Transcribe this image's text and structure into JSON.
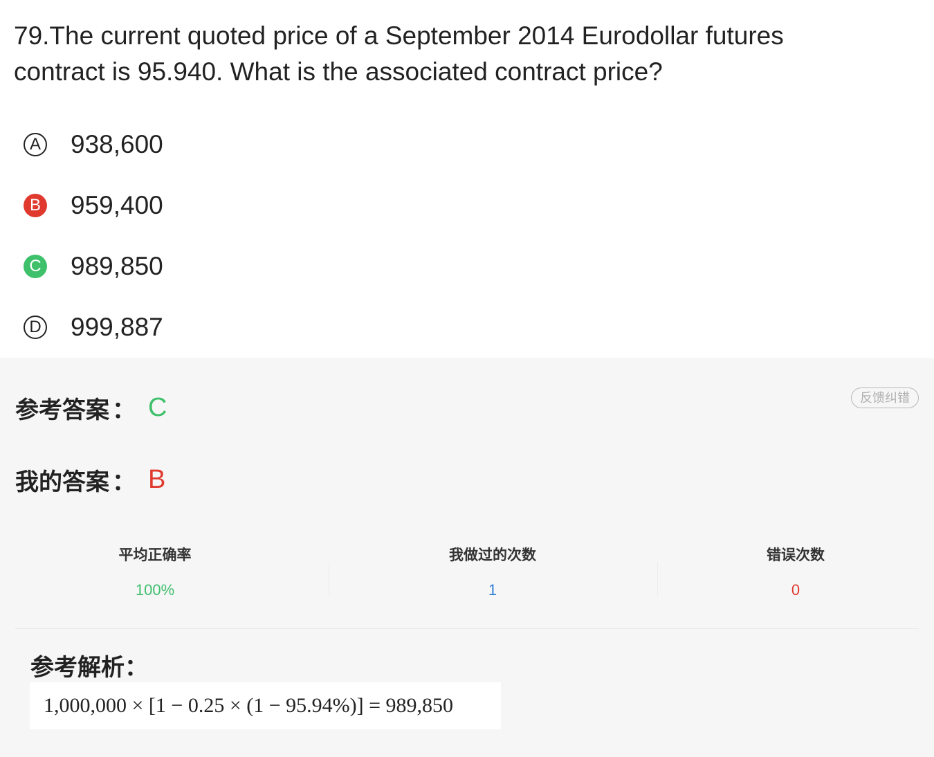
{
  "question": {
    "text": "79.The current quoted price of a September 2014 Eurodollar futures contract is 95.940. What is the associated contract price?"
  },
  "options": [
    {
      "letter": "A",
      "text": "938,600",
      "state": "normal"
    },
    {
      "letter": "B",
      "text": "959,400",
      "state": "wrong"
    },
    {
      "letter": "C",
      "text": "989,850",
      "state": "correct"
    },
    {
      "letter": "D",
      "text": "999,887",
      "state": "normal"
    }
  ],
  "answers": {
    "reference_label": "参考答案",
    "reference_value": "C",
    "mine_label": "我的答案",
    "mine_value": "B",
    "colon": "："
  },
  "feedback_button": "反馈纠错",
  "stats": [
    {
      "label": "平均正确率",
      "value": "100%",
      "color": "#3fbf6e"
    },
    {
      "label": "我做过的次数",
      "value": "1",
      "color": "#2f7fd6"
    },
    {
      "label": "错误次数",
      "value": "0",
      "color": "#e03a2f"
    }
  ],
  "analysis": {
    "title": "参考解析：",
    "formula": "1,000,000 × [1 − 0.25 × (1 − 95.94%)] = 989,850"
  },
  "colors": {
    "correct": "#3fc06a",
    "wrong": "#e03a2f",
    "panel_bg": "#f6f6f6"
  }
}
